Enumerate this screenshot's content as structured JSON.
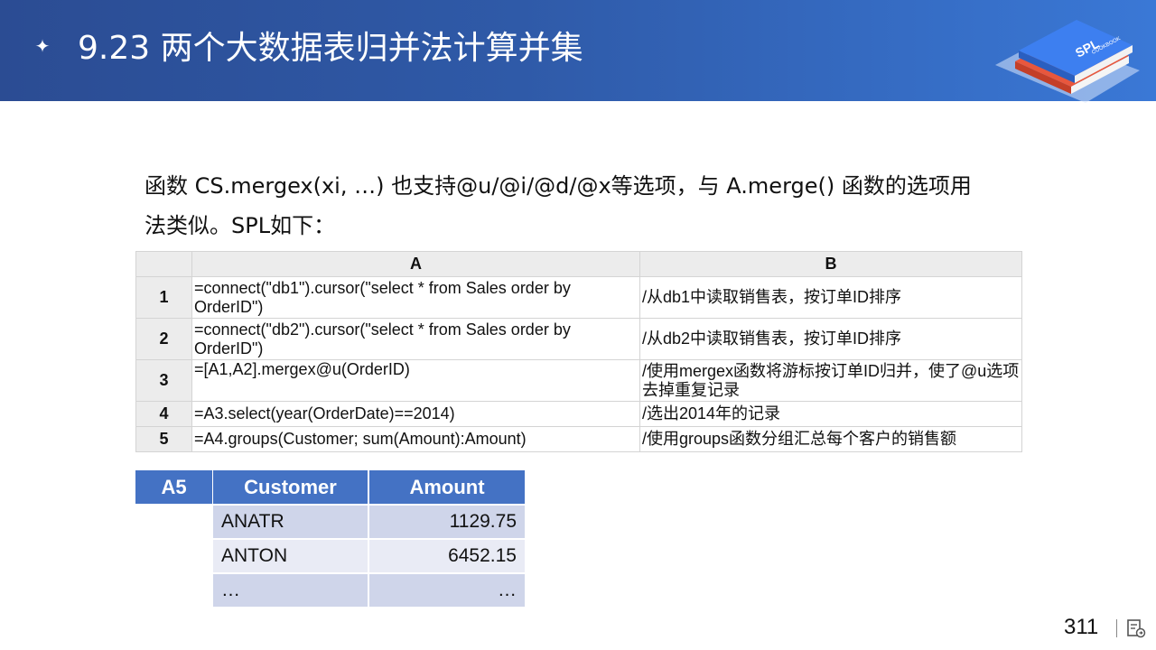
{
  "header": {
    "bullet": "✦",
    "title": "9.23 两个大数据表归并法计算并集",
    "logo_text": "SPL",
    "logo_subtext": "COOKBOOK"
  },
  "intro": {
    "line1": "函数 CS.mergex(xi, …) 也支持@u/@i/@d/@x等选项，与 A.merge() 函数的选项用",
    "line2": "法类似。SPL如下："
  },
  "code_table": {
    "columns": [
      "A",
      "B"
    ],
    "rows": [
      {
        "num": "1",
        "a": "=connect(\"db1\").cursor(\"select * from Sales order by OrderID\")",
        "b": "/从db1中读取销售表，按订单ID排序"
      },
      {
        "num": "2",
        "a": "=connect(\"db2\").cursor(\"select * from Sales order by OrderID\")",
        "b": "/从db2中读取销售表，按订单ID排序"
      },
      {
        "num": "3",
        "a": "=[A1,A2].mergex@u(OrderID)",
        "b": "/使用mergex函数将游标按订单ID归并，使了@u选项去掉重复记录"
      },
      {
        "num": "4",
        "a": "=A3.select(year(OrderDate)==2014)",
        "b": "/选出2014年的记录"
      },
      {
        "num": "5",
        "a": "=A4.groups(Customer; sum(Amount):Amount)",
        "b": "/使用groups函数分组汇总每个客户的销售额"
      }
    ]
  },
  "result_table": {
    "label": "A5",
    "columns": [
      "Customer",
      "Amount"
    ],
    "rows": [
      [
        "ANATR",
        "1129.75"
      ],
      [
        "ANTON",
        "6452.15"
      ],
      [
        "…",
        "…"
      ]
    ]
  },
  "footer": {
    "page_number": "311"
  },
  "colors": {
    "header_start": "#2b4c93",
    "header_end": "#3a78d6",
    "result_header": "#4472c4",
    "result_row_dark": "#cfd5ea",
    "result_row_light": "#e9ebf5"
  }
}
